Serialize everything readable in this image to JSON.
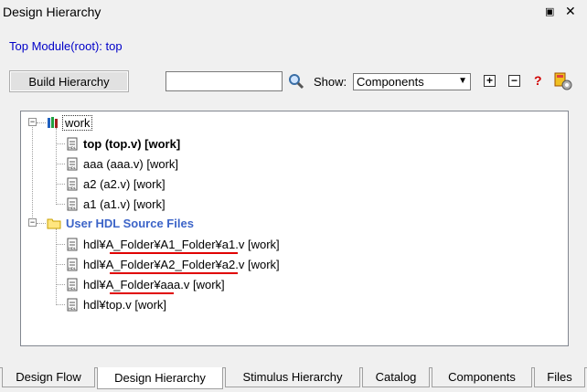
{
  "window": {
    "title": "Design Hierarchy",
    "pin_icon": "pin-icon",
    "close_icon": "close-icon"
  },
  "top_module": "Top Module(root): top",
  "toolbar": {
    "build_label": "Build Hierarchy",
    "search_value": "",
    "show_label": "Show:",
    "show_value": "Components",
    "expand_icon": "expand-all-icon",
    "collapse_icon": "collapse-all-icon",
    "help_icon": "help-icon",
    "settings_icon": "settings-icon"
  },
  "tree": {
    "work": {
      "label": "work",
      "children": [
        "top (top.v) [work]",
        "aaa (aaa.v) [work]",
        "a2 (a2.v) [work]",
        "a1 (a1.v) [work]"
      ]
    },
    "user_hdl": {
      "label": "User HDL Source Files",
      "children": [
        {
          "prefix": "hdl¥",
          "under": "A_Folder¥A1_Folder",
          "suffix": "¥a1.v [work]"
        },
        {
          "prefix": "hdl¥",
          "under": "A_Folder¥A2_Folder",
          "suffix": "¥a2.v [work]"
        },
        {
          "prefix": "hdl¥",
          "under": "A_Folder",
          "suffix": "¥aaa.v [work]"
        },
        {
          "prefix": "hdl¥top.v [work]",
          "under": "",
          "suffix": ""
        }
      ]
    }
  },
  "tabs": [
    "Design Flow",
    "Design Hierarchy",
    "Stimulus Hierarchy",
    "Catalog",
    "Components",
    "Files"
  ],
  "active_tab": "Design Hierarchy",
  "colors": {
    "link_blue": "#0000c8",
    "folder_label": "#3c64c8",
    "underline": "#e00000"
  }
}
